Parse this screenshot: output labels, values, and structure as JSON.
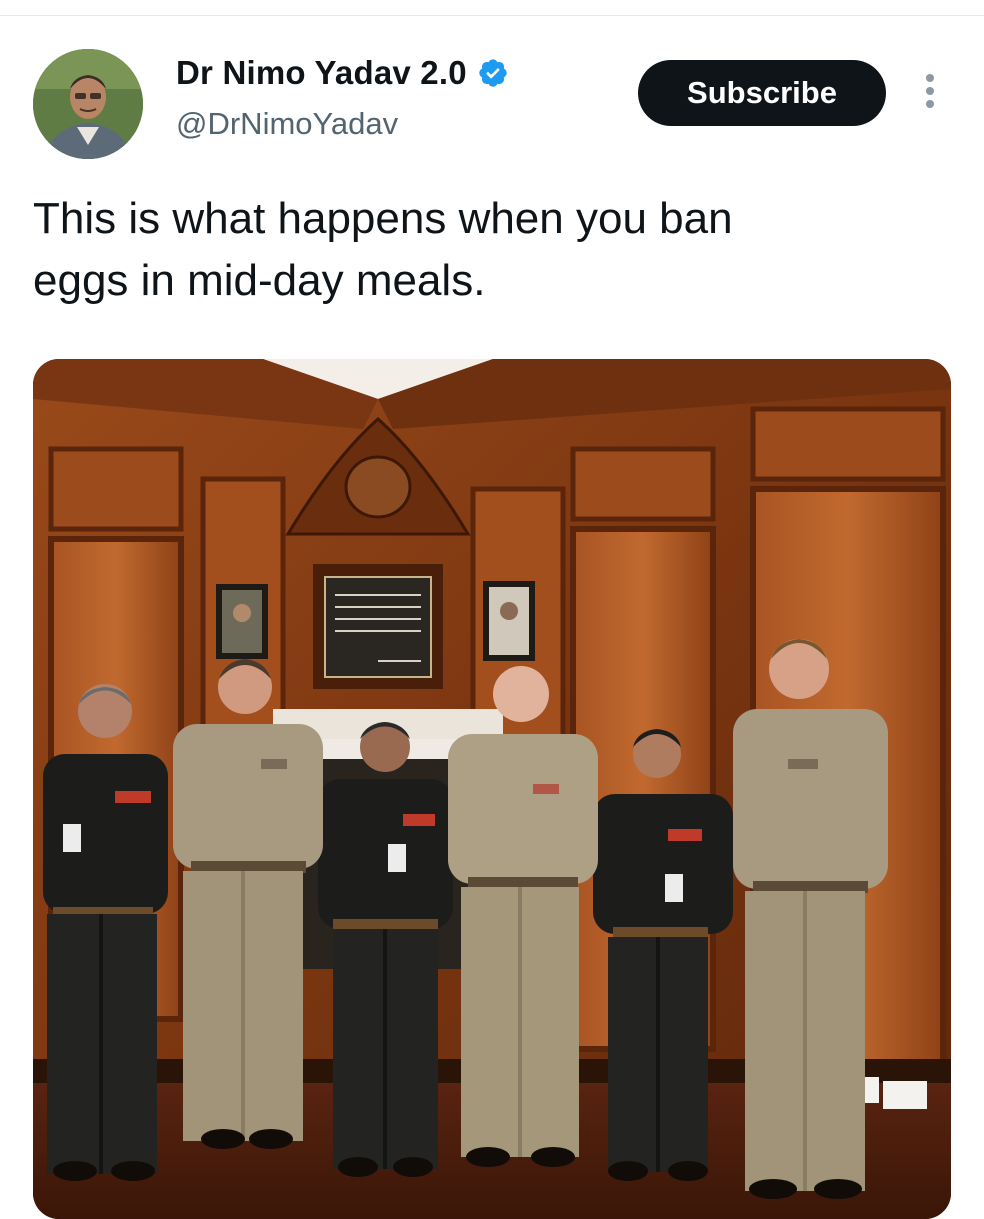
{
  "post": {
    "author": {
      "display_name": "Dr Nimo Yadav 2.0",
      "handle": "@DrNimoYadav",
      "verified": true,
      "avatar_icon": "user-avatar-photo"
    },
    "subscribe_label": "Subscribe",
    "more_icon": "more-vertical-icon",
    "text_line1": "This is what happens when you ban",
    "text_line2": "eggs in mid-day meals.",
    "media": {
      "type": "photo",
      "people_count": 6
    }
  },
  "colors": {
    "text_primary": "#0f1419",
    "text_secondary": "#536471",
    "verified_blue": "#1d9bf0",
    "button_bg": "#0f1419",
    "wood": "#8a3f16",
    "uniform_dark": "#1c1c1a",
    "uniform_tan": "#a89a80"
  }
}
